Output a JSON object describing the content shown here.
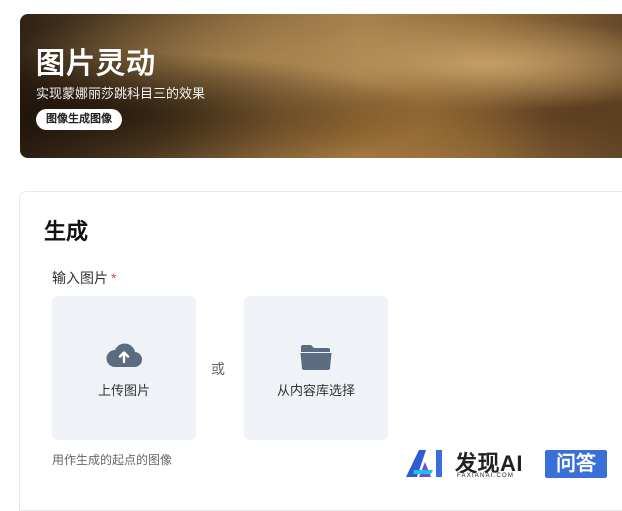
{
  "banner": {
    "title": "图片灵动",
    "subtitle": "实现蒙娜丽莎跳科目三的效果",
    "tag": "图像生成图像"
  },
  "generate": {
    "section_title": "生成",
    "input_label": "输入图片",
    "required_mark": "*",
    "upload": {
      "label": "上传图片",
      "icon": "cloud-upload-icon"
    },
    "or_text": "或",
    "library": {
      "label": "从内容库选择",
      "icon": "folder-icon"
    },
    "helper": "用作生成的起点的图像"
  },
  "watermark": {
    "brand": "发现AI",
    "sub": "FAXIANAI.COM",
    "badge": "问答"
  },
  "colors": {
    "tile_bg": "#eff2f7",
    "icon": "#5b6b80",
    "required": "#e5484d",
    "badge": "#3b6fd8"
  }
}
